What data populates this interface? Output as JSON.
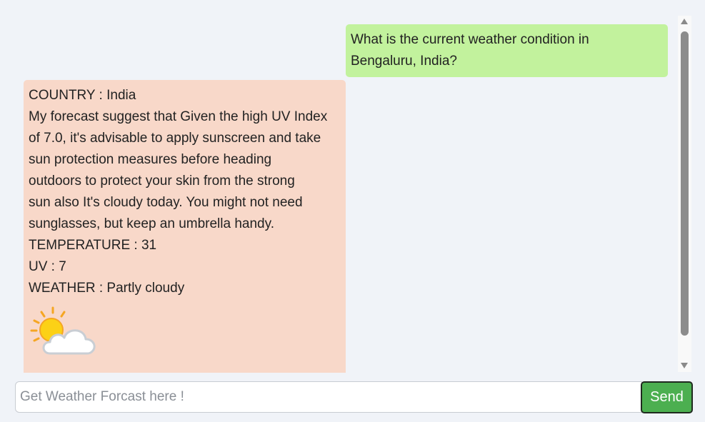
{
  "chat": {
    "messages": [
      {
        "role": "user",
        "lines": [
          "What is the current weather condition in",
          "Bengaluru, India?"
        ]
      },
      {
        "role": "bot",
        "lines": [
          "COUNTRY : India",
          "My forecast suggest that Given the high UV Index",
          "of 7.0, it's advisable to apply sunscreen and take",
          "sun protection measures before heading",
          "outdoors to protect your skin from the strong",
          "sun also It's cloudy today. You might not need",
          "sunglasses, but keep an umbrella handy.",
          "TEMPERATURE : 31",
          "UV : 7",
          "WEATHER : Partly cloudy"
        ],
        "icon": "partly-cloudy-icon"
      }
    ]
  },
  "input": {
    "placeholder": "Get Weather Forcast here !",
    "value": ""
  },
  "send_button": {
    "label": "Send"
  },
  "colors": {
    "page_bg": "#f0f3f8",
    "user_bubble": "#c2f29d",
    "bot_bubble": "#f8d8c9",
    "send_button": "#4caf50"
  }
}
